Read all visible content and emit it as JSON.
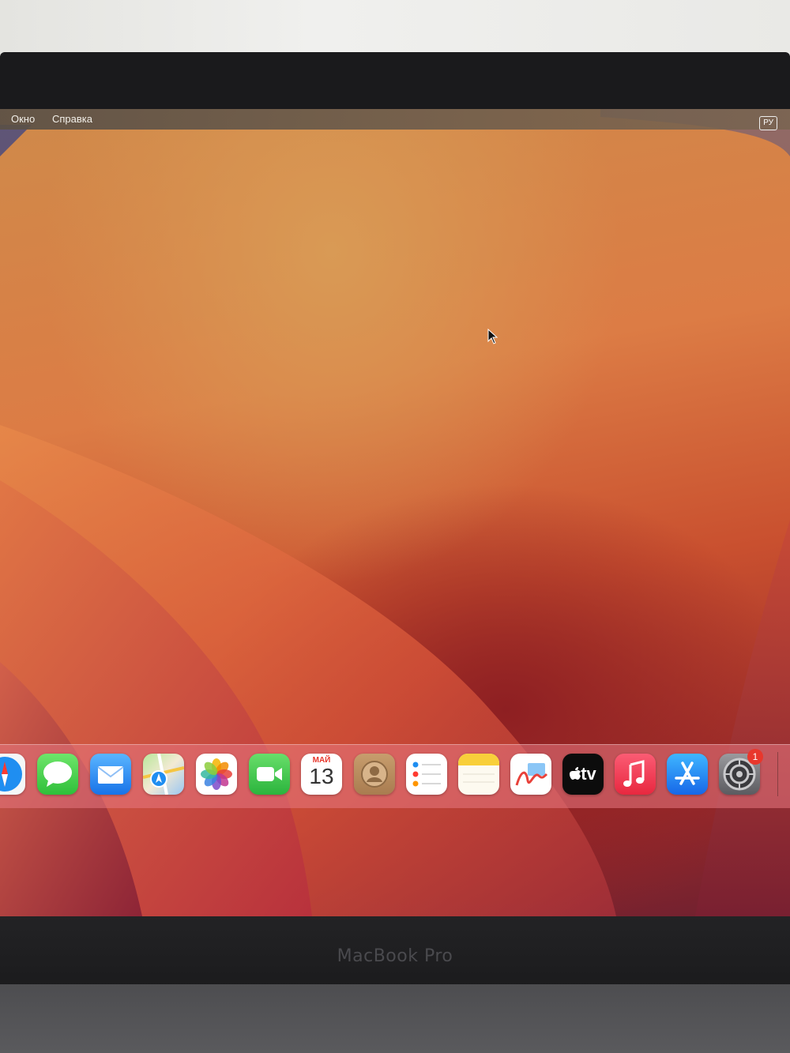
{
  "menubar": {
    "items": [
      "Окно",
      "Справка"
    ],
    "input_language": "РУ"
  },
  "dock": {
    "apps": [
      {
        "name": "Safari",
        "icon": "safari-icon"
      },
      {
        "name": "Messages",
        "icon": "messages-icon"
      },
      {
        "name": "Mail",
        "icon": "mail-icon"
      },
      {
        "name": "Maps",
        "icon": "maps-icon"
      },
      {
        "name": "Photos",
        "icon": "photos-icon"
      },
      {
        "name": "FaceTime",
        "icon": "facetime-icon"
      },
      {
        "name": "Calendar",
        "icon": "calendar-icon",
        "month": "МАЙ",
        "day": "13"
      },
      {
        "name": "Contacts",
        "icon": "contacts-icon"
      },
      {
        "name": "Reminders",
        "icon": "reminders-icon"
      },
      {
        "name": "Notes",
        "icon": "notes-icon"
      },
      {
        "name": "Freeform",
        "icon": "freeform-icon"
      },
      {
        "name": "Apple TV",
        "icon": "appletv-icon",
        "label": "tv"
      },
      {
        "name": "Music",
        "icon": "music-icon"
      },
      {
        "name": "App Store",
        "icon": "appstore-icon"
      },
      {
        "name": "System Settings",
        "icon": "settings-icon",
        "badge": "1"
      }
    ]
  },
  "device": {
    "label": "MacBook Pro"
  },
  "colors": {
    "wallpaper_light": "#dc8a4c",
    "wallpaper_dark": "#8e1f22",
    "dock_tint": "#e87882"
  }
}
